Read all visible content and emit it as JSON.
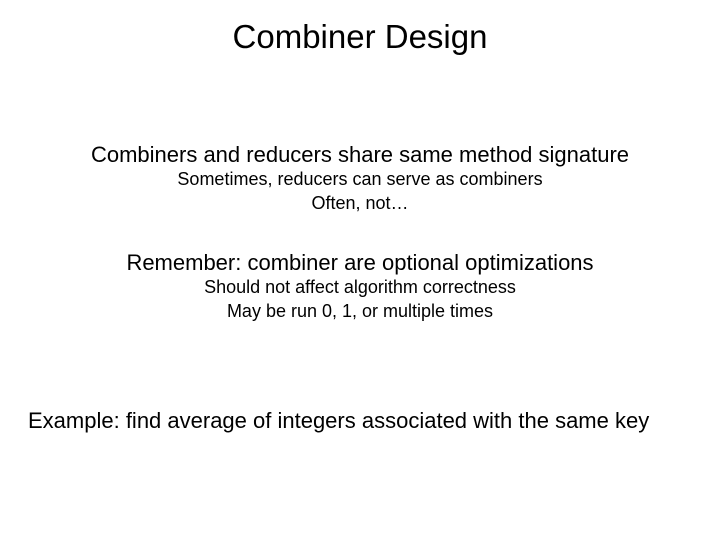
{
  "title": "Combiner Design",
  "block1": {
    "lead": "Combiners and reducers share same method signature",
    "sub1": "Sometimes, reducers can serve as combiners",
    "sub2": "Often, not…"
  },
  "block2": {
    "lead": "Remember: combiner are optional optimizations",
    "sub1": "Should not affect algorithm correctness",
    "sub2": "May be run 0, 1, or multiple times"
  },
  "example": "Example: find average of integers associated with the same key"
}
